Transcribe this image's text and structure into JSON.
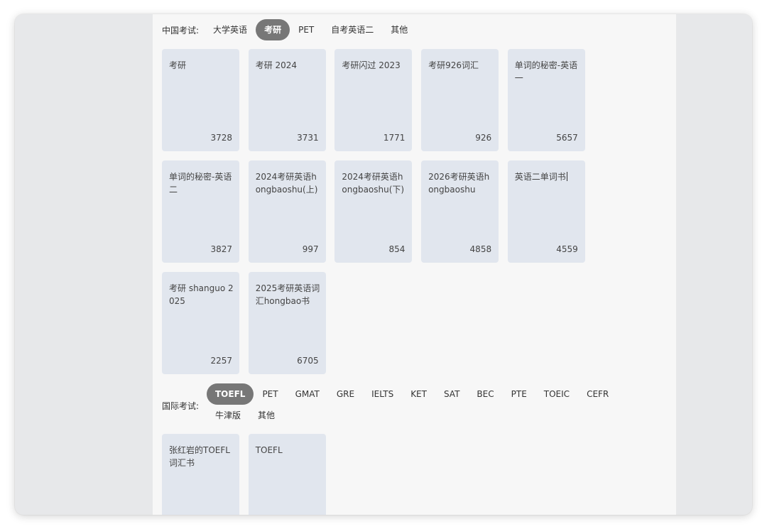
{
  "cn_exams": {
    "label": "中国考试:",
    "tabs": [
      {
        "label": "大学英语",
        "active": false
      },
      {
        "label": "考研",
        "active": true
      },
      {
        "label": "PET",
        "active": false
      },
      {
        "label": "自考英语二",
        "active": false
      },
      {
        "label": "其他",
        "active": false
      }
    ],
    "books": [
      {
        "title": "考研",
        "count": "3728"
      },
      {
        "title": "考研 2024",
        "count": "3731"
      },
      {
        "title": "考研闪过 2023",
        "count": "1771"
      },
      {
        "title": "考研926词汇",
        "count": "926"
      },
      {
        "title": "单词的秘密-英语一",
        "count": "5657"
      },
      {
        "title": "单词的秘密-英语二",
        "count": "3827"
      },
      {
        "title": "2024考研英语hongbaoshu(上)",
        "count": "997"
      },
      {
        "title": "2024考研英语hongbaoshu(下)",
        "count": "854"
      },
      {
        "title": "2026考研英语hongbaoshu",
        "count": "4858"
      },
      {
        "title": "英语二单词书",
        "count": "4559"
      },
      {
        "title": "考研 shanguo 2025",
        "count": "2257"
      },
      {
        "title": "2025考研英语词汇hongbao书",
        "count": "6705"
      }
    ]
  },
  "intl_exams": {
    "label": "国际考试:",
    "tabs_line1": [
      {
        "label": "TOEFL",
        "active": true
      },
      {
        "label": "PET",
        "active": false
      },
      {
        "label": "GMAT",
        "active": false
      },
      {
        "label": "GRE",
        "active": false
      },
      {
        "label": "IELTS",
        "active": false
      },
      {
        "label": "KET",
        "active": false
      },
      {
        "label": "SAT",
        "active": false
      },
      {
        "label": "BEC",
        "active": false
      },
      {
        "label": "PTE",
        "active": false
      },
      {
        "label": "TOEIC",
        "active": false
      },
      {
        "label": "CEFR",
        "active": false
      }
    ],
    "tabs_line2": [
      {
        "label": "牛津版",
        "active": false
      },
      {
        "label": "其他",
        "active": false
      }
    ],
    "books": [
      {
        "title": "张红岩的TOEFL词汇书",
        "count": ""
      },
      {
        "title": "TOEFL",
        "count": ""
      }
    ]
  },
  "colors": {
    "active_pill": "#777777",
    "card_bg": "#e1e6ee",
    "panel_bg": "#f7f7f7",
    "outer_bg": "#e7e8ea"
  }
}
